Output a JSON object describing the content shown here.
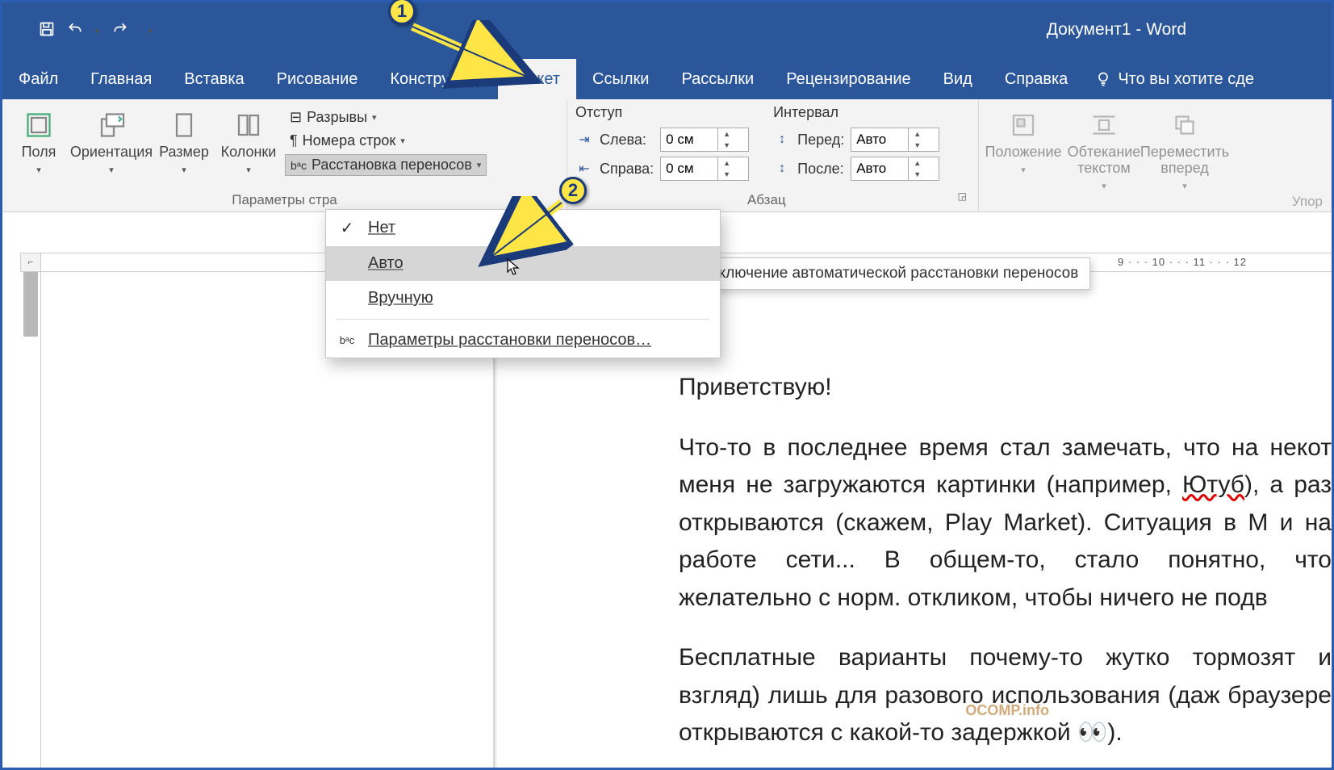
{
  "title": "Документ1  -  Word",
  "qat": {
    "save": "save-icon",
    "undo": "undo-icon",
    "redo": "redo-icon"
  },
  "tabs": [
    "Файл",
    "Главная",
    "Вставка",
    "Рисование",
    "Конструктор",
    "Макет",
    "Ссылки",
    "Рассылки",
    "Рецензирование",
    "Вид",
    "Справка"
  ],
  "active_tab": "Макет",
  "tell_me": "Что вы хотите сде",
  "ribbon": {
    "page_setup": {
      "margins": "Поля",
      "orientation": "Ориентация",
      "size": "Размер",
      "columns": "Колонки",
      "breaks": "Разрывы",
      "line_numbers": "Номера строк",
      "hyphenation": "Расстановка переносов",
      "group_label": "Параметры стра"
    },
    "paragraph": {
      "indent_header": "Отступ",
      "spacing_header": "Интервал",
      "left_label": "Слева:",
      "right_label": "Справа:",
      "before_label": "Перед:",
      "after_label": "После:",
      "left_value": "0 см",
      "right_value": "0 см",
      "before_value": "Авто",
      "after_value": "Авто",
      "group_label": "Абзац"
    },
    "arrange": {
      "position": "Положение",
      "wrap": "Обтекание текстом",
      "forward": "Переместить вперед",
      "group_label": "Упор"
    }
  },
  "dropdown": {
    "none": "Нет",
    "auto": "Авто",
    "manual": "Вручную",
    "options": "Параметры расстановки переносов…"
  },
  "tooltip": "Включение автоматической расстановки переносов",
  "ruler_right": "9  ·  ·  ·  10  ·  ·  ·  11  ·  ·  ·  12",
  "document": {
    "p1": "Приветствую!",
    "p2a": "Что-то в последнее время стал замечать, что на некот меня не загружаются картинки (например, ",
    "p2b": "Ютуб",
    "p2c": "), а раз открываются (скажем, Play Market). Ситуация в M и на работе сети... В общем-то, стало понятно, что желательно с норм. откликом, чтобы ничего не подв",
    "p3": "Бесплатные варианты почему-то жутко тормозят и взгляд) лишь для разового использования (даж браузере открываются с какой-то задержкой 👀)."
  },
  "callouts": {
    "one": "1",
    "two": "2"
  },
  "watermark": "OCOMP.info"
}
